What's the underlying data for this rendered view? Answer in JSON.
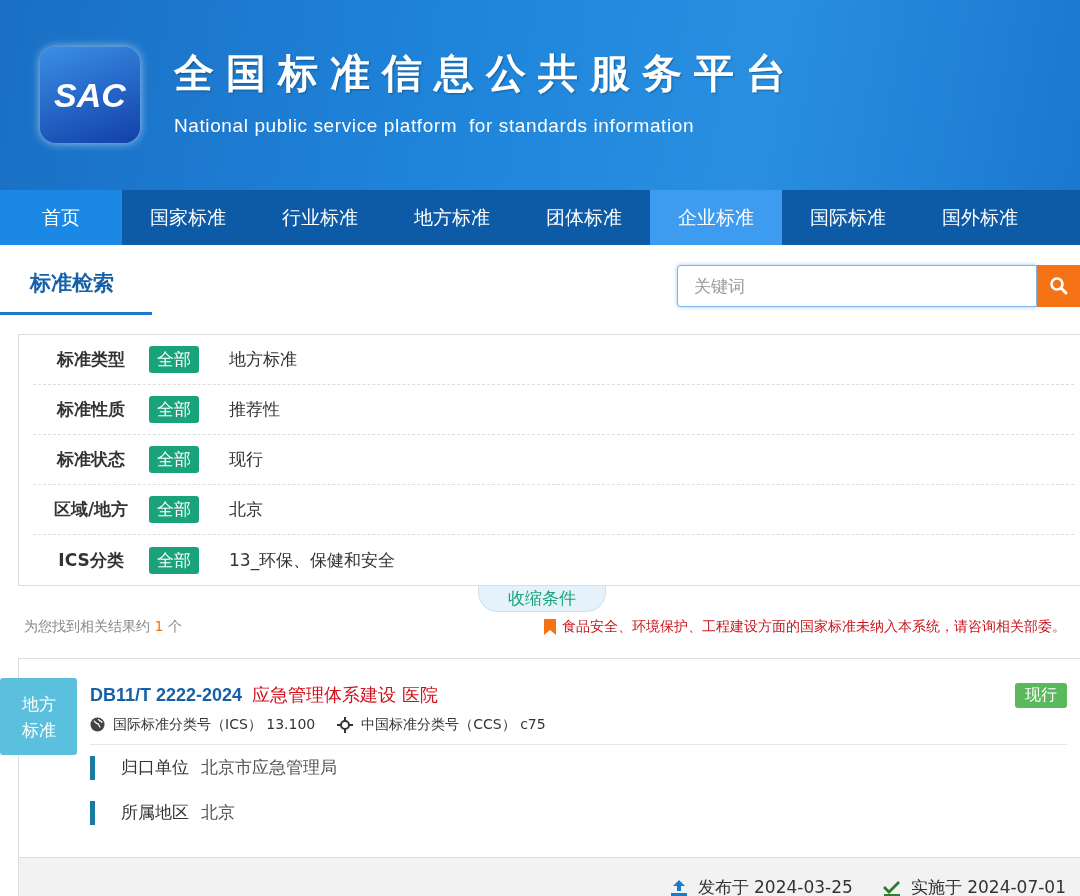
{
  "header": {
    "logo_text": "SAC",
    "title": "全国标准信息公共服务平台",
    "subtitle": "National public service platform  for standards information"
  },
  "nav": [
    {
      "label": "首页",
      "kind": "home",
      "selected": false
    },
    {
      "label": "国家标准",
      "kind": "link",
      "selected": false
    },
    {
      "label": "行业标准",
      "kind": "link",
      "selected": false
    },
    {
      "label": "地方标准",
      "kind": "link",
      "selected": false
    },
    {
      "label": "团体标准",
      "kind": "link",
      "selected": false
    },
    {
      "label": "企业标准",
      "kind": "link",
      "selected": true
    },
    {
      "label": "国际标准",
      "kind": "link",
      "selected": false
    },
    {
      "label": "国外标准",
      "kind": "link",
      "selected": false
    }
  ],
  "search": {
    "tab": "标准检索",
    "placeholder": "关键词"
  },
  "filters": [
    {
      "label": "标准类型",
      "tag": "全部",
      "value": "地方标准"
    },
    {
      "label": "标准性质",
      "tag": "全部",
      "value": "推荐性"
    },
    {
      "label": "标准状态",
      "tag": "全部",
      "value": "现行"
    },
    {
      "label": "区域/地方",
      "tag": "全部",
      "value": "北京"
    },
    {
      "label": "ICS分类",
      "tag": "全部",
      "value": "13_环保、保健和安全"
    }
  ],
  "collapse_button": "收缩条件",
  "result_count": {
    "prefix": "为您找到相关结果约",
    "count": "1",
    "suffix": "个"
  },
  "notice": "食品安全、环境保护、工程建设方面的国家标准未纳入本系统，请咨询相关部委。",
  "results": [
    {
      "badge": "地方标准",
      "code": "DB11/T 2222-2024",
      "name": "应急管理体系建设 医院",
      "status": "现行",
      "ics_label": "国际标准分类号（ICS）",
      "ics": "13.100",
      "ccs_label": "中国标准分类号（CCS）",
      "ccs": "c75",
      "fields": [
        {
          "label": "归口单位",
          "value": "北京市应急管理局"
        },
        {
          "label": "所属地区",
          "value": "北京"
        }
      ],
      "published": "发布于 2024-03-25",
      "effective": "实施于 2024-07-01"
    }
  ]
}
